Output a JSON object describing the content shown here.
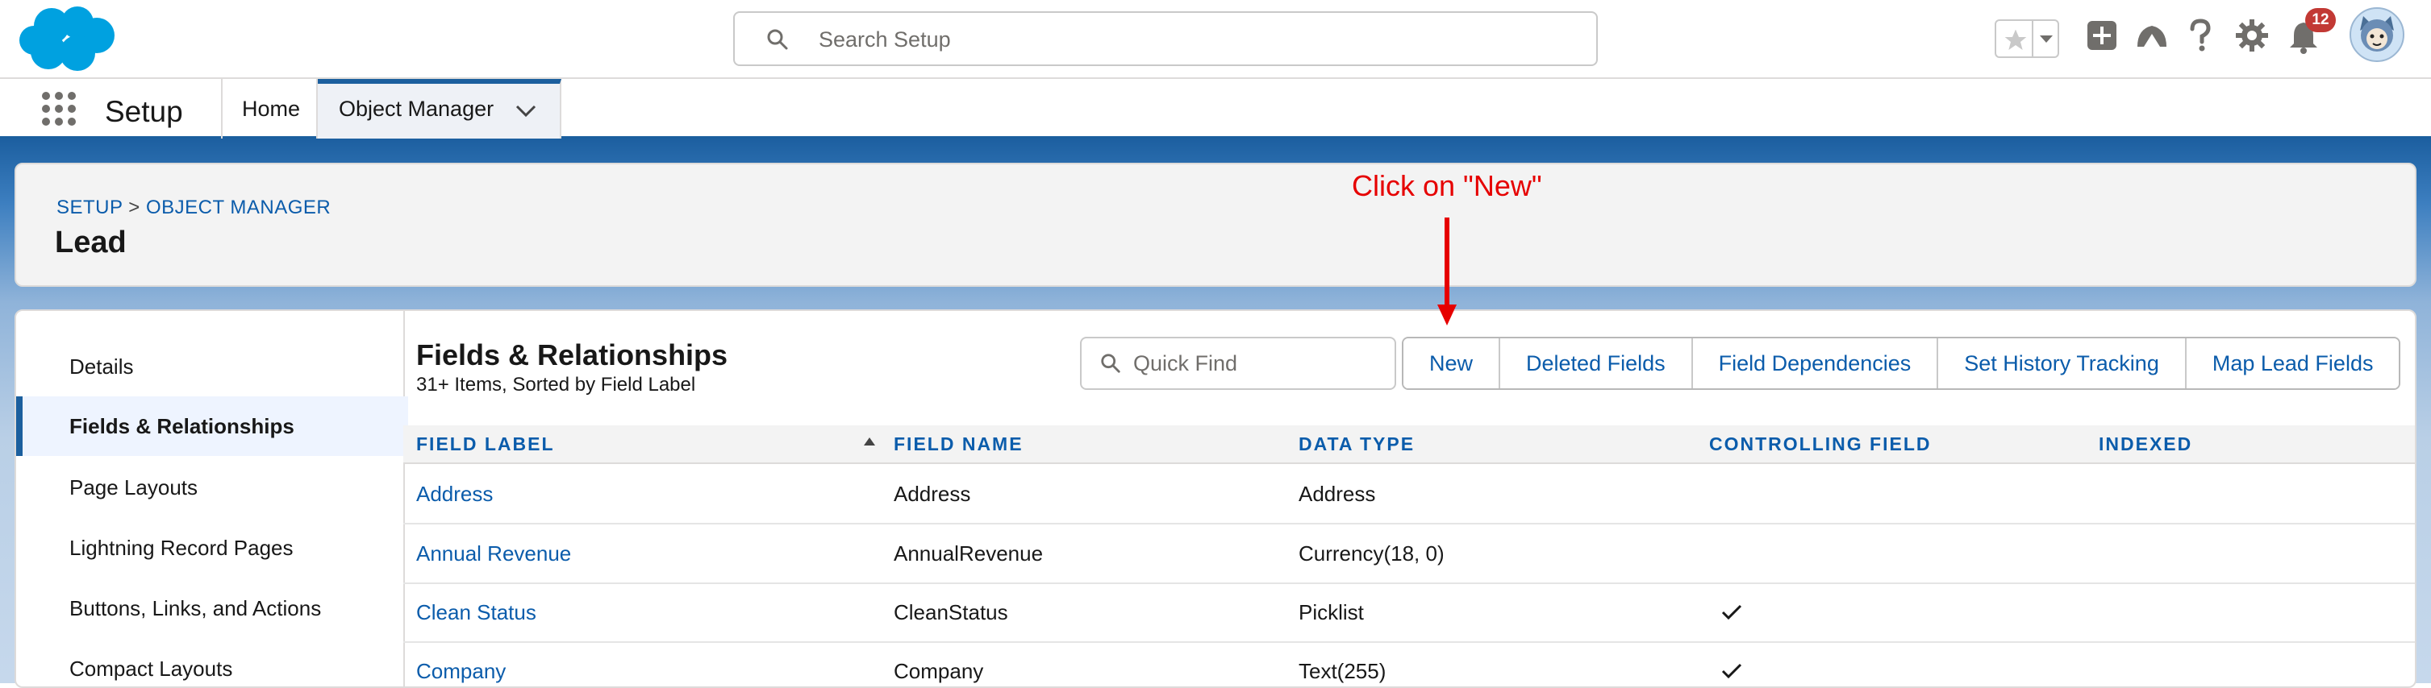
{
  "header": {
    "search_placeholder": "Search Setup",
    "notifications_count": "12"
  },
  "nav": {
    "app_name": "Setup",
    "tabs": [
      {
        "label": "Home"
      },
      {
        "label": "Object Manager"
      }
    ]
  },
  "page": {
    "breadcrumb": {
      "setup": "SETUP",
      "separator": ">",
      "object_manager": "OBJECT MANAGER"
    },
    "object_title": "Lead"
  },
  "annotation": {
    "text": "Click on \"New\""
  },
  "sidebar": {
    "items": [
      {
        "label": "Details"
      },
      {
        "label": "Fields & Relationships"
      },
      {
        "label": "Page Layouts"
      },
      {
        "label": "Lightning Record Pages"
      },
      {
        "label": "Buttons, Links, and Actions"
      },
      {
        "label": "Compact Layouts"
      }
    ]
  },
  "section": {
    "title": "Fields & Relationships",
    "subtitle": "31+ Items, Sorted by Field Label",
    "quick_find_placeholder": "Quick Find",
    "buttons": [
      "New",
      "Deleted Fields",
      "Field Dependencies",
      "Set History Tracking",
      "Map Lead Fields"
    ]
  },
  "table": {
    "headers": [
      "FIELD LABEL",
      "FIELD NAME",
      "DATA TYPE",
      "CONTROLLING FIELD",
      "INDEXED"
    ],
    "rows": [
      {
        "label": "Address",
        "name": "Address",
        "type": "Address",
        "controlling": "",
        "indexed": false
      },
      {
        "label": "Annual Revenue",
        "name": "AnnualRevenue",
        "type": "Currency(18, 0)",
        "controlling": "",
        "indexed": false
      },
      {
        "label": "Clean Status",
        "name": "CleanStatus",
        "type": "Picklist",
        "controlling": "",
        "indexed": true
      },
      {
        "label": "Company",
        "name": "Company",
        "type": "Text(255)",
        "controlling": "",
        "indexed": true
      }
    ]
  },
  "colors": {
    "brand": "#1b5f9e",
    "link": "#0b5cab",
    "annotation": "#e60000",
    "badge": "#c23934"
  }
}
